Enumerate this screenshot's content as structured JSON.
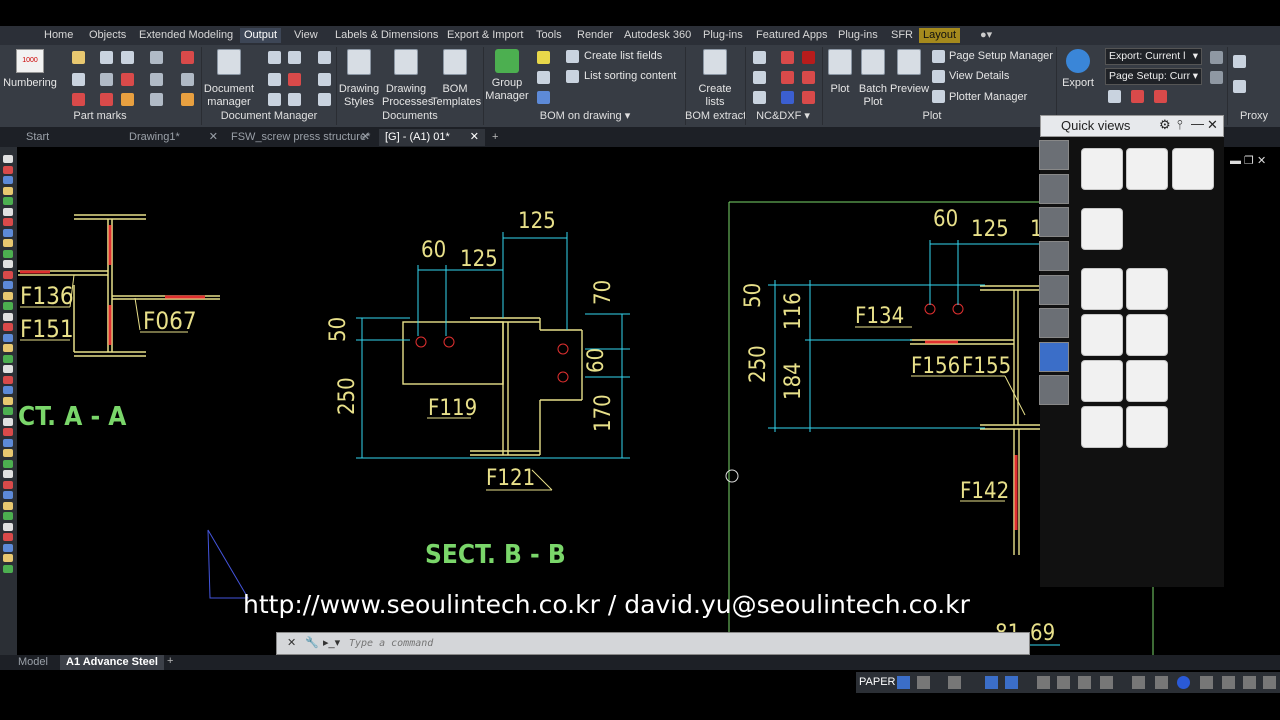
{
  "ribbon_tabs": [
    "Home",
    "Objects",
    "Extended Modeling",
    "Output",
    "View",
    "Labels & Dimensions",
    "Export & Import",
    "Tools",
    "Render",
    "Autodesk 360",
    "Plug-ins",
    "Featured Apps",
    "Plug-ins",
    "SFR",
    "Layout"
  ],
  "active_tab": "Output",
  "panels": {
    "part_marks": {
      "title": "Part marks",
      "numbering": "Numbering",
      "numbering_icon_text": "1000"
    },
    "doc_manager": {
      "title": "Document Manager",
      "document_manager": "Document manager"
    },
    "documents": {
      "title": "Documents",
      "drawing_styles": "Drawing Styles",
      "drawing_processes": "Drawing Processes",
      "bom_templates": "BOM Templates"
    },
    "bom_on_drawing": {
      "title": "BOM on drawing",
      "group_manager": "Group Manager",
      "create_list_fields": "Create list fields",
      "list_sorting_content": "List sorting  content"
    },
    "bom_extract": {
      "title": "BOM extract",
      "create_lists": "Create lists"
    },
    "ncdxf": {
      "title": "NC&DXF"
    },
    "plot": {
      "title": "Plot",
      "plot": "Plot",
      "batch_plot": "Batch Plot",
      "preview": "Preview",
      "page_setup_manager": "Page Setup Manager",
      "view_details": "View Details",
      "plotter_manager": "Plotter Manager"
    },
    "export": {
      "export": "Export",
      "export_combo": "Export: Current l",
      "page_setup_combo": "Page Setup: Curr"
    },
    "proxy": {
      "title": "Proxy"
    }
  },
  "doc_tabs": [
    "Start",
    "Drawing1*",
    "FSW_screw press structure*",
    "[G] - (A1) 01*"
  ],
  "quick_views": {
    "title": "Quick views"
  },
  "command_line": {
    "placeholder": "Type a command"
  },
  "layout_tabs": [
    "Model",
    "A1 Advance Steel"
  ],
  "status": {
    "paper": "PAPER"
  },
  "watermark": "http://www.seoulintech.co.kr / david.yu@seoulintech.co.kr",
  "drawing": {
    "sect_a_marks": [
      "F136",
      "F151",
      "F067"
    ],
    "sect_a_title": "CT. A - A",
    "sect_b_dims": [
      "125",
      "60",
      "125",
      "70",
      "50",
      "60",
      "250",
      "170"
    ],
    "sect_b_marks": [
      "F119",
      "F121"
    ],
    "sect_b_title": "SECT. B - B",
    "right_dims": [
      "60",
      "125",
      "1",
      "50",
      "116",
      "250",
      "184",
      "81",
      "69"
    ],
    "right_marks": [
      "F134",
      "F156",
      "F155",
      "F142"
    ]
  },
  "colors": {
    "ribbon": "#373c44",
    "tabbar": "#2b2f37",
    "cad_cyan": "#33d6f0",
    "cad_yellow": "#e8e08a",
    "cad_green": "#7ad66a",
    "cad_red": "#e03030"
  }
}
